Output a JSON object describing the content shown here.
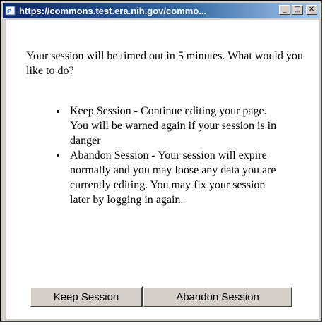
{
  "window": {
    "title": "https://commons.test.era.nih.gov/commo...",
    "minimize_symbol": "_",
    "maximize_symbol": "□",
    "close_symbol": "✕",
    "icon": "internet-explorer-icon"
  },
  "dialog": {
    "message": "Your session will be timed out in 5 minutes. What would you like to do?",
    "options": [
      "Keep Session - Continue editing your page. You will be warned again if your session is in danger",
      "Abandon Session - Your session will expire normally and you may loose any data you are currently editing. You may fix your session later by logging in again."
    ],
    "keep_button_label": "Keep Session",
    "abandon_button_label": "Abandon Session"
  }
}
